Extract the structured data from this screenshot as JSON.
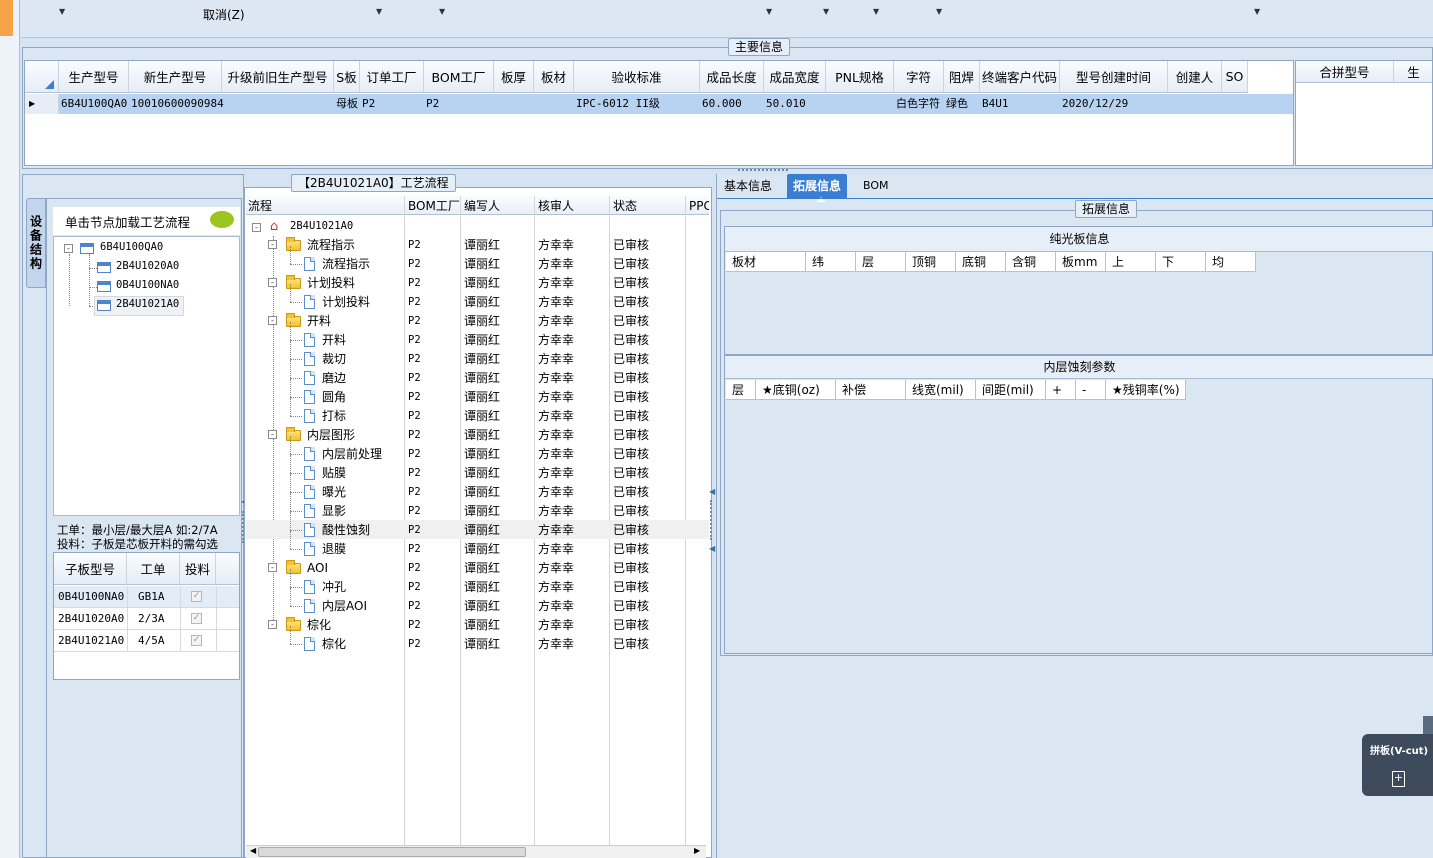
{
  "topbar": {
    "cancel_label": "取消(Z)"
  },
  "main_info": {
    "legend": "主要信息",
    "columns": [
      "生产型号",
      "新生产型号",
      "升级前旧生产型号",
      "S板",
      "订单工厂",
      "BOM工厂",
      "板厚",
      "板材",
      "验收标准",
      "成品长度",
      "成品宽度",
      "PNL规格",
      "字符",
      "阻焊",
      "终端客户代码",
      "型号创建时间",
      "创建人",
      "SO"
    ],
    "row": [
      "6B4U100QA0",
      "10010600090984",
      "",
      "母板",
      "P2",
      "P2",
      "",
      "",
      "IPC-6012 II级",
      "60.000",
      "50.010",
      "",
      "白色字符",
      "绿色",
      "B4U1",
      "2020/12/29",
      "",
      ""
    ],
    "merge_columns": [
      "合拼型号",
      "生"
    ]
  },
  "left_panel": {
    "vertical_tab": "设备结构",
    "hint": "单击节点加载工艺流程",
    "tree": {
      "root": "6B4U100QA0",
      "children": [
        "2B4U1020A0",
        "0B4U100NA0",
        "2B4U1021A0"
      ]
    },
    "note1": "工单：最小层/最大层A 如:2/7A",
    "note2": "投料：子板是芯板开料的需勾选",
    "sub_columns": [
      "子板型号",
      "工单",
      "投料"
    ],
    "sub_rows": [
      {
        "model": "0B4U100NA0",
        "order": "GB1A",
        "checked": "✓"
      },
      {
        "model": "2B4U1020A0",
        "order": "2/3A",
        "checked": "✓"
      },
      {
        "model": "2B4U1021A0",
        "order": "4/5A",
        "checked": "✓"
      }
    ]
  },
  "process": {
    "legend": "【2B4U1021A0】工艺流程",
    "columns": [
      "流程",
      "BOM工厂",
      "编写人",
      "核审人",
      "状态",
      "PPC"
    ],
    "root": "2B4U1021A0",
    "rows": [
      {
        "name": "流程指示",
        "folder": true,
        "bom": "P2",
        "writer": "谭丽红",
        "reviewer": "方幸幸",
        "status": "已审核"
      },
      {
        "name": "流程指示",
        "folder": false,
        "bom": "P2",
        "writer": "谭丽红",
        "reviewer": "方幸幸",
        "status": "已审核"
      },
      {
        "name": "计划投料",
        "folder": true,
        "bom": "P2",
        "writer": "谭丽红",
        "reviewer": "方幸幸",
        "status": "已审核"
      },
      {
        "name": "计划投料",
        "folder": false,
        "bom": "P2",
        "writer": "谭丽红",
        "reviewer": "方幸幸",
        "status": "已审核"
      },
      {
        "name": "开料",
        "folder": true,
        "bom": "P2",
        "writer": "谭丽红",
        "reviewer": "方幸幸",
        "status": "已审核"
      },
      {
        "name": "开料",
        "folder": false,
        "bom": "P2",
        "writer": "谭丽红",
        "reviewer": "方幸幸",
        "status": "已审核"
      },
      {
        "name": "裁切",
        "folder": false,
        "bom": "P2",
        "writer": "谭丽红",
        "reviewer": "方幸幸",
        "status": "已审核"
      },
      {
        "name": "磨边",
        "folder": false,
        "bom": "P2",
        "writer": "谭丽红",
        "reviewer": "方幸幸",
        "status": "已审核"
      },
      {
        "name": "圆角",
        "folder": false,
        "bom": "P2",
        "writer": "谭丽红",
        "reviewer": "方幸幸",
        "status": "已审核"
      },
      {
        "name": "打标",
        "folder": false,
        "bom": "P2",
        "writer": "谭丽红",
        "reviewer": "方幸幸",
        "status": "已审核"
      },
      {
        "name": "内层图形",
        "folder": true,
        "bom": "P2",
        "writer": "谭丽红",
        "reviewer": "方幸幸",
        "status": "已审核"
      },
      {
        "name": "内层前处理",
        "folder": false,
        "bom": "P2",
        "writer": "谭丽红",
        "reviewer": "方幸幸",
        "status": "已审核"
      },
      {
        "name": "贴膜",
        "folder": false,
        "bom": "P2",
        "writer": "谭丽红",
        "reviewer": "方幸幸",
        "status": "已审核"
      },
      {
        "name": "曝光",
        "folder": false,
        "bom": "P2",
        "writer": "谭丽红",
        "reviewer": "方幸幸",
        "status": "已审核"
      },
      {
        "name": "显影",
        "folder": false,
        "bom": "P2",
        "writer": "谭丽红",
        "reviewer": "方幸幸",
        "status": "已审核"
      },
      {
        "name": "酸性蚀刻",
        "folder": false,
        "bom": "P2",
        "writer": "谭丽红",
        "reviewer": "方幸幸",
        "status": "已审核"
      },
      {
        "name": "退膜",
        "folder": false,
        "bom": "P2",
        "writer": "谭丽红",
        "reviewer": "方幸幸",
        "status": "已审核"
      },
      {
        "name": "AOI",
        "folder": true,
        "bom": "P2",
        "writer": "谭丽红",
        "reviewer": "方幸幸",
        "status": "已审核"
      },
      {
        "name": "冲孔",
        "folder": false,
        "bom": "P2",
        "writer": "谭丽红",
        "reviewer": "方幸幸",
        "status": "已审核"
      },
      {
        "name": "内层AOI",
        "folder": false,
        "bom": "P2",
        "writer": "谭丽红",
        "reviewer": "方幸幸",
        "status": "已审核"
      },
      {
        "name": "棕化",
        "folder": true,
        "bom": "P2",
        "writer": "谭丽红",
        "reviewer": "方幸幸",
        "status": "已审核"
      },
      {
        "name": "棕化",
        "folder": false,
        "bom": "P2",
        "writer": "谭丽红",
        "reviewer": "方幸幸",
        "status": "已审核"
      }
    ]
  },
  "right": {
    "tabs": [
      "基本信息",
      "拓展信息",
      "BOM"
    ],
    "legend": "拓展信息",
    "bare_board_title": "纯光板信息",
    "bare_board_cols": [
      "板材",
      "纬",
      "层",
      "顶铜",
      "底铜",
      "含铜",
      "板mm",
      "上",
      "下",
      "均"
    ],
    "etch_title": "内层蚀刻参数",
    "etch_cols": [
      "层",
      "★底铜(oz)",
      "补偿",
      "线宽(mil)",
      "间距(mil)",
      "+",
      "-",
      "★残铜率(%)"
    ],
    "float_panel_title": "拼板(V-cut)"
  }
}
